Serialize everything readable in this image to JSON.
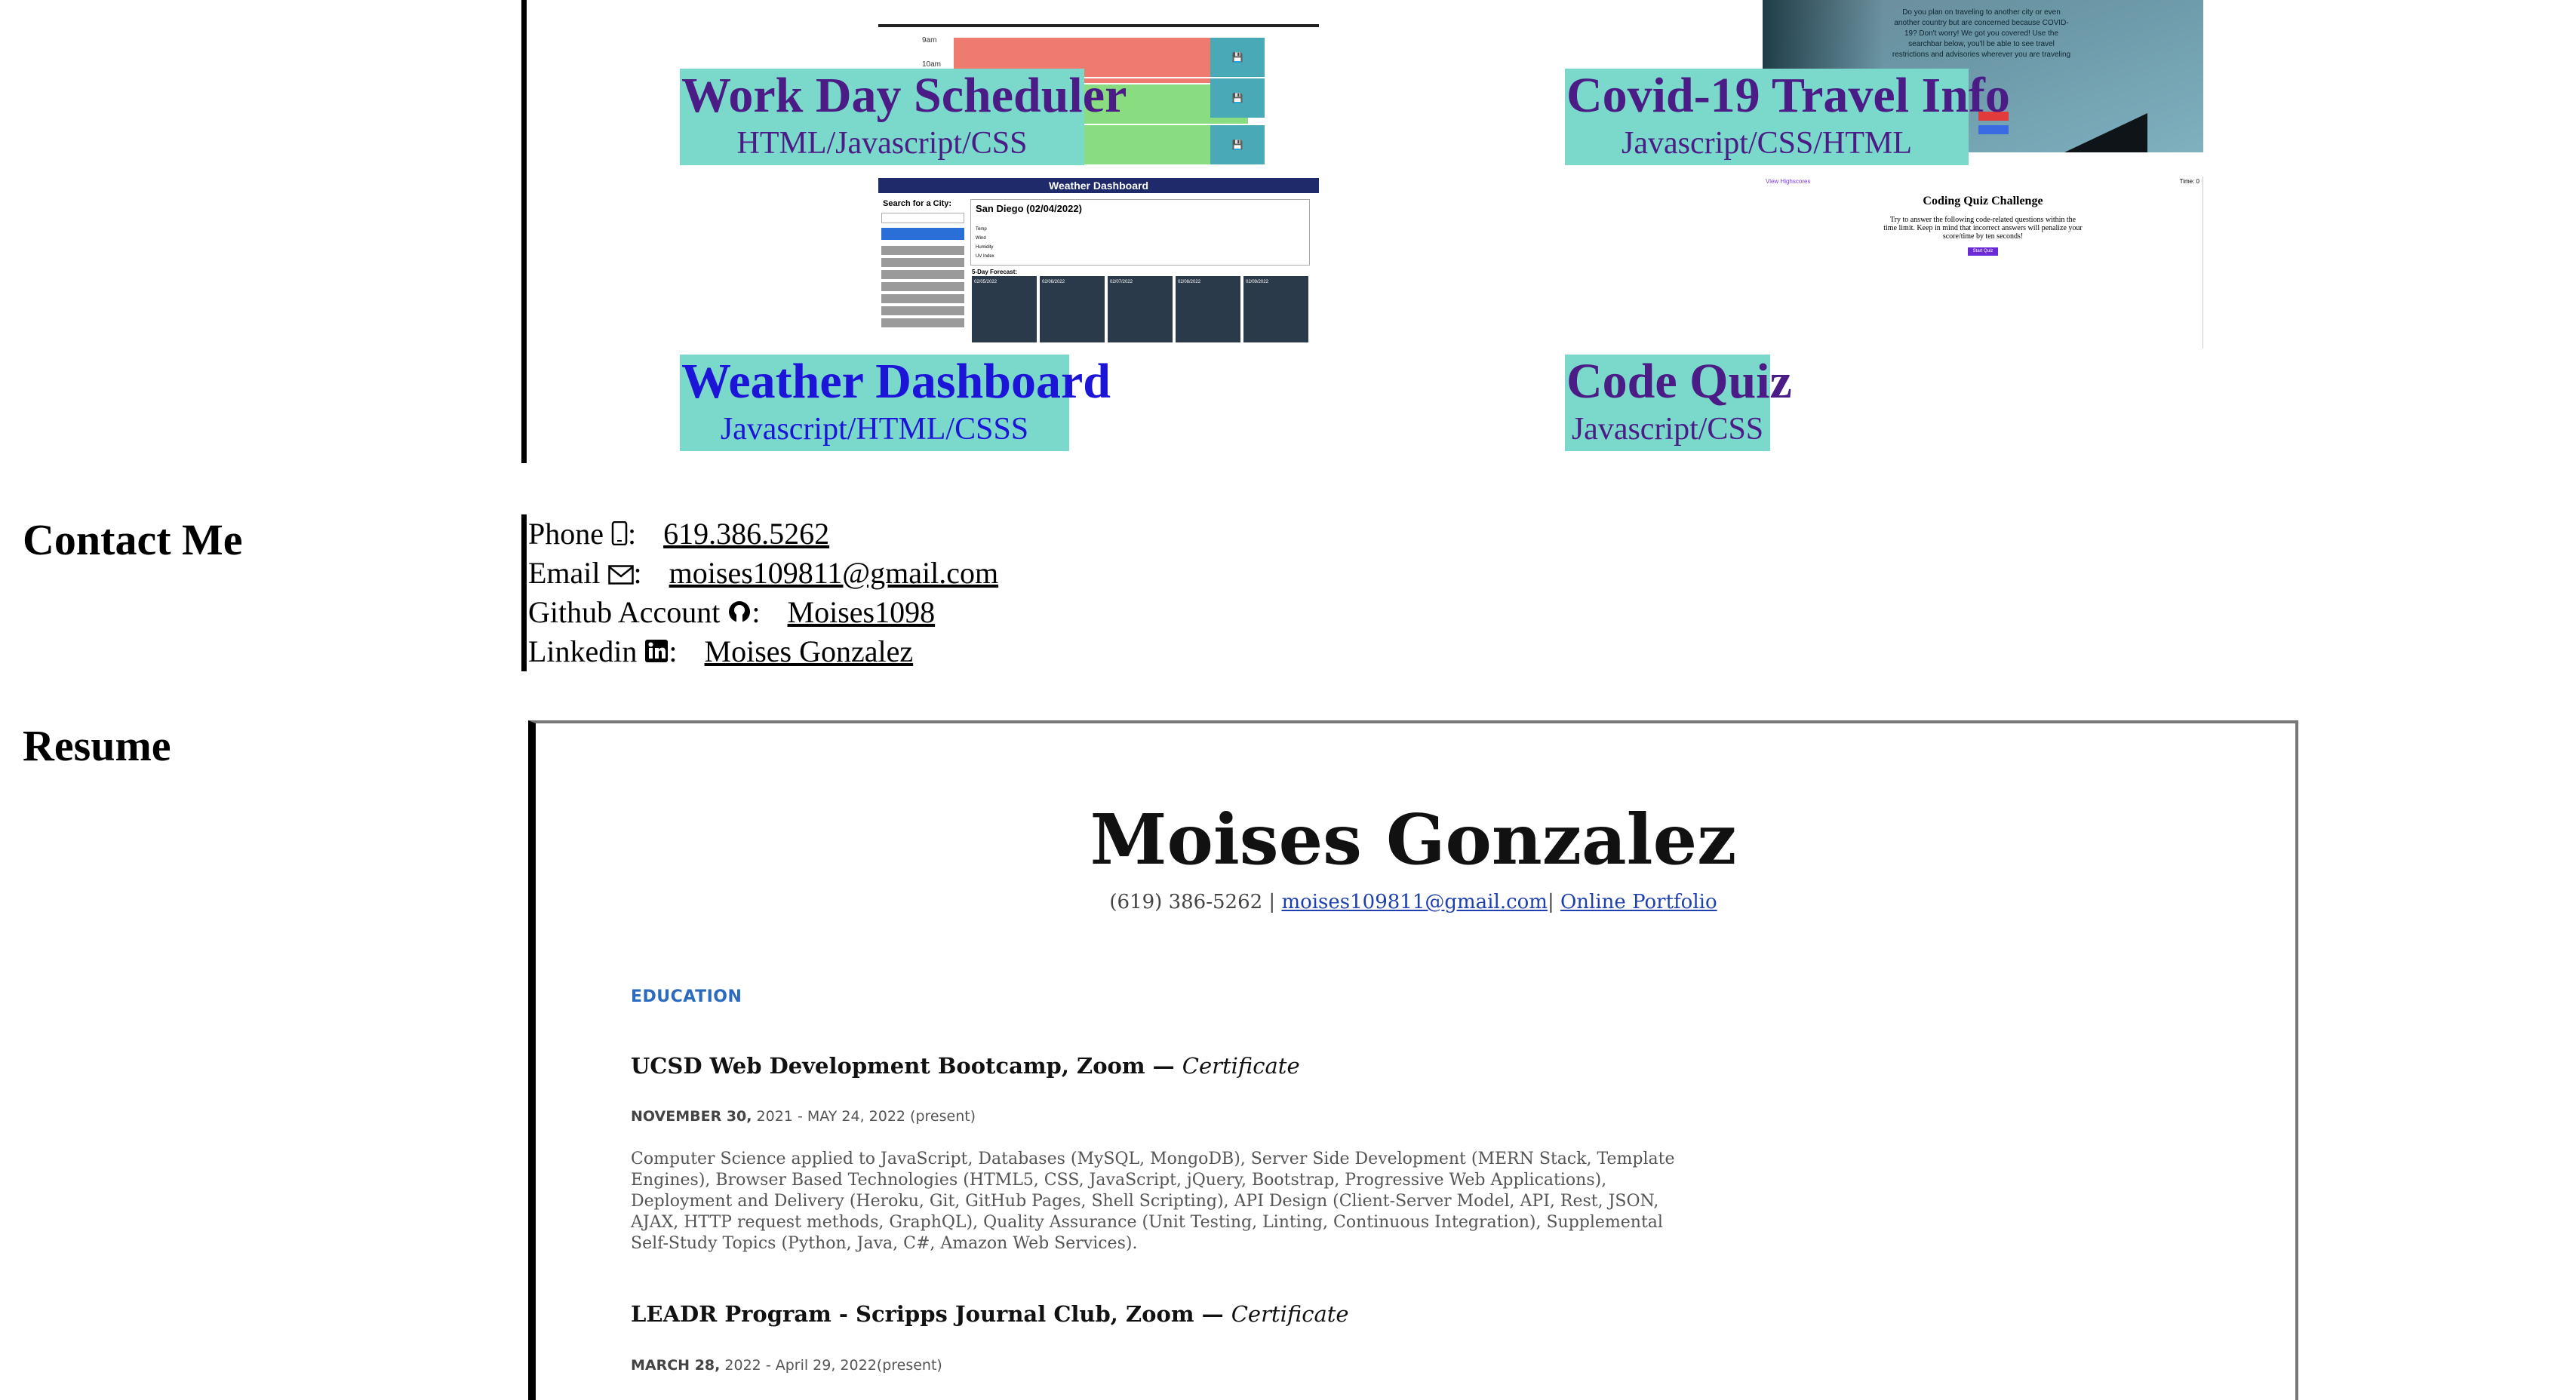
{
  "projects": [
    {
      "name": "Work Day Scheduler",
      "tech": "HTML/Javascript/CSS"
    },
    {
      "name": "Covid-19 Travel Info",
      "tech": "Javascript/CSS/HTML"
    },
    {
      "name": "Weather Dashboard",
      "tech": "Javascript/HTML/CSSS"
    },
    {
      "name": "Code Quiz",
      "tech": "Javascript/CSS"
    }
  ],
  "thumbnails": {
    "covid_text": "Do you plan on traveling to another city or even another country but are concerned because COVID-19? Don't worry! We got you covered! Use the searchbar below, you'll be able to see travel restrictions and advisories wherever you are traveling",
    "weather_header": "Weather Dashboard",
    "weather_search_label": "Search for a City:",
    "weather_current": "San Diego (02/04/2022)",
    "weather_forecast_label": "5-Day Forecast:",
    "weather_days": [
      "02/05/2022",
      "02/06/2022",
      "02/07/2022",
      "02/08/2022",
      "02/09/2022"
    ],
    "quiz_highscores": "View Highscores",
    "quiz_time": "Time: 0",
    "quiz_title": "Coding Quiz Challenge",
    "quiz_desc": "Try to answer the following code-related questions within the time limit. Keep in mind that incorrect answers will penalize your score/time by ten seconds!",
    "quiz_start": "Start Quiz"
  },
  "contact": {
    "heading": "Contact Me",
    "phone_label": "Phone",
    "phone_value": "619.386.5262",
    "email_label": "Email",
    "email_value": "moises109811@gmail.com",
    "github_label": "Github Account",
    "github_value": "Moises1098",
    "linkedin_label": "Linkedin",
    "linkedin_value": "Moises Gonzalez",
    "separator": ":"
  },
  "resume": {
    "heading": "Resume",
    "name": "Moises Gonzalez",
    "phone": "(619) 386-5262 |",
    "email": "moises109811@gmail.com",
    "divider": "|",
    "portfolio": "Online Portfolio",
    "education_label": "EDUCATION",
    "entries": [
      {
        "title": "UCSD Web Development Bootcamp, Zoom —",
        "credential": "Certificate",
        "date_start": "NOVEMBER 30,",
        "date_rest": "2021 - MAY 24, 2022 (present)",
        "description": "Computer Science applied to JavaScript, Databases (MySQL, MongoDB), Server Side Development (MERN Stack, Template Engines), Browser Based Technologies (HTML5, CSS, JavaScript, jQuery, Bootstrap, Progressive Web Applications), Deployment and Delivery (Heroku, Git, GitHub Pages, Shell Scripting), API Design (Client-Server Model, API, Rest, JSON, AJAX, HTTP request methods, GraphQL), Quality Assurance (Unit Testing, Linting, Continuous Integration), Supplemental Self-Study Topics (Python, Java, C#, Amazon Web Services)."
      },
      {
        "title": "LEADR Program - Scripps Journal Club, Zoom —",
        "credential": "Certificate",
        "date_start": "MARCH 28,",
        "date_rest": "2022 - April 29, 2022(present)"
      }
    ]
  },
  "colors": {
    "caption_bg": "#7ad9cb",
    "caption_text": "#4b1b86",
    "caption_link_blue": "#1c14d6",
    "resume_accent": "#2a6bbf"
  }
}
